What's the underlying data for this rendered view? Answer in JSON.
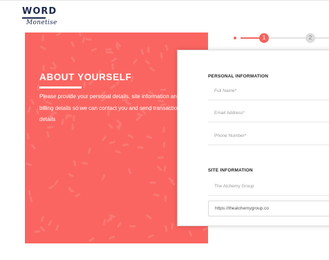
{
  "logo": {
    "word": "WORD",
    "script": "Monetise"
  },
  "stepper": {
    "steps": [
      {
        "label": "1",
        "state": "active"
      },
      {
        "label": "2",
        "state": "inactive"
      }
    ]
  },
  "about": {
    "title": "ABOUT YOURSELF",
    "description": "Please provide  your personal details, site information and billing details so we can contact you and send transaction details",
    "background_color": "#fb6561"
  },
  "form": {
    "personal_heading": "PERSONAL INFORMATION",
    "full_name_placeholder": "Full Name*",
    "email_placeholder": "Email Address*",
    "phone_placeholder": "Phone Number*",
    "site_heading": "SITE INFORMATION",
    "site_name_value": "The Alchemy Group",
    "site_url_value": "https://thealchemygroup.co"
  },
  "colors": {
    "accent": "#f2655e",
    "brand_navy": "#1d2a4d"
  }
}
